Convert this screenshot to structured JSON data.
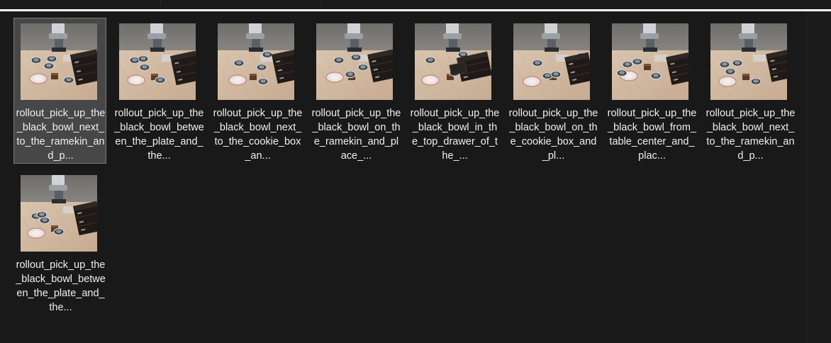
{
  "colors": {
    "background": "#191919",
    "selected_tile": "#474747",
    "selected_border": "#787878",
    "caption_text": "#f0f0f0",
    "accent_line": "#ffffff"
  },
  "files": [
    {
      "caption": "rollout_pick_up_the_black_bowl_next_to_the_ramekin_and_p...",
      "selected": true,
      "icon": "video-thumbnail"
    },
    {
      "caption": "rollout_pick_up_the_black_bowl_between_the_plate_and_the...",
      "selected": false,
      "icon": "video-thumbnail"
    },
    {
      "caption": "rollout_pick_up_the_black_bowl_next_to_the_cookie_box_an...",
      "selected": false,
      "icon": "video-thumbnail"
    },
    {
      "caption": "rollout_pick_up_the_black_bowl_on_the_ramekin_and_place_...",
      "selected": false,
      "icon": "video-thumbnail"
    },
    {
      "caption": "rollout_pick_up_the_black_bowl_in_the_top_drawer_of_the_...",
      "selected": false,
      "icon": "video-thumbnail"
    },
    {
      "caption": "rollout_pick_up_the_black_bowl_on_the_cookie_box_and_pl...",
      "selected": false,
      "icon": "video-thumbnail"
    },
    {
      "caption": "rollout_pick_up_the_black_bowl_from_table_center_and_plac...",
      "selected": false,
      "icon": "video-thumbnail"
    },
    {
      "caption": "rollout_pick_up_the_black_bowl_next_to_the_ramekin_and_p...",
      "selected": false,
      "icon": "video-thumbnail"
    },
    {
      "caption": "rollout_pick_up_the_black_bowl_between_the_plate_and_the...",
      "selected": false,
      "icon": "video-thumbnail"
    }
  ]
}
